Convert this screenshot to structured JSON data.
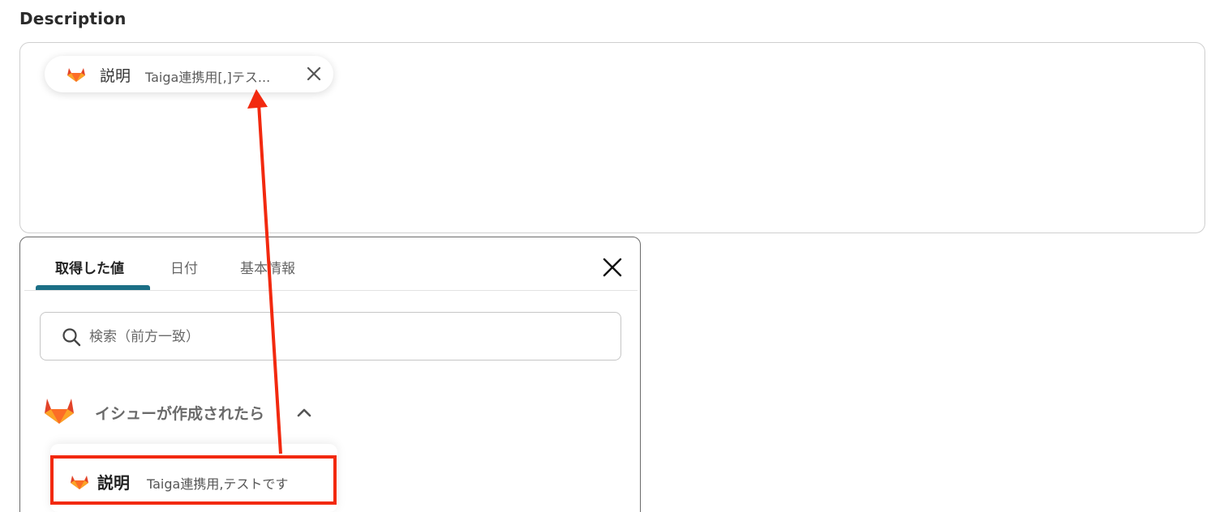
{
  "field": {
    "label": "Description"
  },
  "chip": {
    "name": "説明",
    "value": "Taiga連携用[,]テス...",
    "icon": "gitlab-icon"
  },
  "panel": {
    "tabs": [
      {
        "label": "取得した値",
        "active": true
      },
      {
        "label": "日付",
        "active": false
      },
      {
        "label": "基本情報",
        "active": false
      }
    ],
    "search": {
      "placeholder": "検索（前方一致）",
      "value": ""
    },
    "group": {
      "label": "イシューが作成されたら",
      "icon": "gitlab-icon",
      "expanded": true
    },
    "items": [
      {
        "name": "説明",
        "value": "Taiga連携用,テストです",
        "icon": "gitlab-icon"
      }
    ]
  },
  "colors": {
    "accent_tab": "#1b6f86",
    "highlight": "#f2290f",
    "gitlab_orange": "#e24329",
    "gitlab_light": "#fca326"
  }
}
